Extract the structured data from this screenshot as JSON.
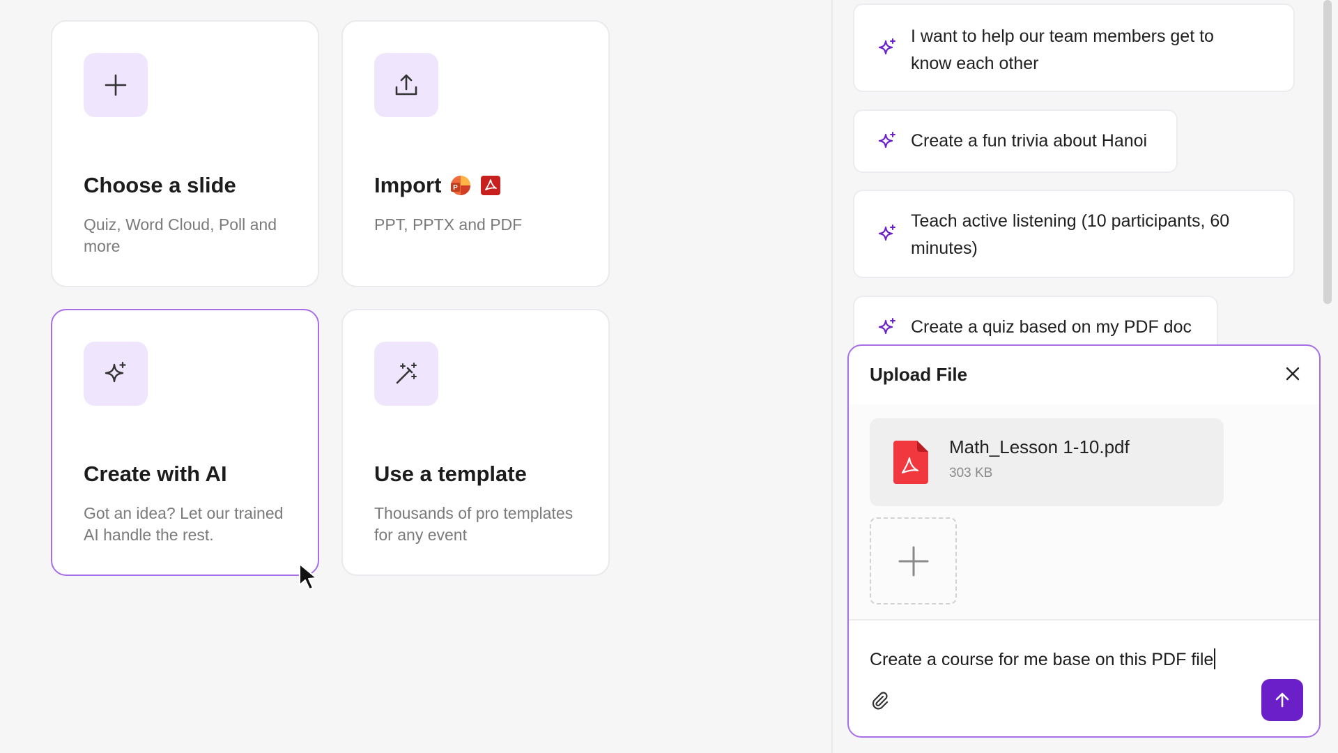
{
  "cards": [
    {
      "title": "Choose a slide",
      "desc": "Quiz, Word Cloud, Poll and more",
      "icon": "plus-icon"
    },
    {
      "title": "Import",
      "desc": "PPT, PPTX and PDF",
      "icon": "upload-icon"
    },
    {
      "title": "Create with AI",
      "desc": "Got an idea? Let our trained AI handle the rest.",
      "icon": "sparkle-icon"
    },
    {
      "title": "Use a template",
      "desc": "Thousands of pro templates for any event",
      "icon": "magic-wand-icon"
    }
  ],
  "suggestions": [
    {
      "text": "I want to help our team members get to know each other"
    },
    {
      "text": "Create a fun trivia about Hanoi"
    },
    {
      "text": "Teach active listening (10 participants, 60 minutes)"
    },
    {
      "text": "Create a quiz based on my PDF doc"
    }
  ],
  "upload": {
    "title": "Upload File",
    "file": {
      "name": "Math_Lesson 1-10.pdf",
      "size": "303 KB"
    },
    "prompt_value": "Create a course for me base on this PDF file"
  },
  "colors": {
    "accent": "#6a1fc9",
    "accent_light": "#efe5fd",
    "border_active": "#a76ee6",
    "pdf_red": "#e8343b"
  }
}
